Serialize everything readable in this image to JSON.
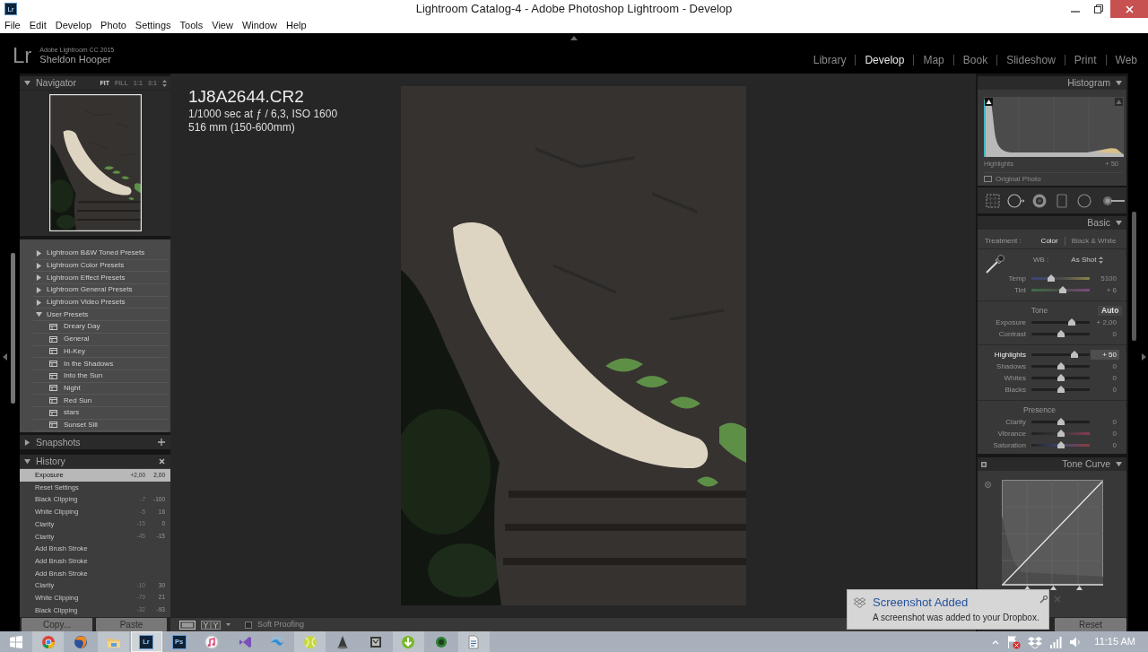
{
  "window": {
    "icon_label": "Lr",
    "title": "Lightroom Catalog-4 - Adobe Photoshop Lightroom - Develop"
  },
  "menu": [
    "File",
    "Edit",
    "Develop",
    "Photo",
    "Settings",
    "Tools",
    "View",
    "Window",
    "Help"
  ],
  "identity": {
    "logo": "Lr",
    "product": "Adobe Lightroom CC 2015",
    "user": "Sheldon Hooper"
  },
  "modules": [
    {
      "label": "Library",
      "selected": false
    },
    {
      "label": "Develop",
      "selected": true
    },
    {
      "label": "Map",
      "selected": false
    },
    {
      "label": "Book",
      "selected": false
    },
    {
      "label": "Slideshow",
      "selected": false
    },
    {
      "label": "Print",
      "selected": false
    },
    {
      "label": "Web",
      "selected": false
    }
  ],
  "left_panel": {
    "navigator": {
      "title": "Navigator",
      "expanded": true,
      "zoom_options": [
        {
          "label": "FIT",
          "selected": true
        },
        {
          "label": "FILL",
          "selected": false
        },
        {
          "label": "1:1",
          "selected": false
        },
        {
          "label": "3:1",
          "selected": false
        }
      ]
    },
    "presets": [
      {
        "label": "Lightroom B&W Toned Presets",
        "expanded": false
      },
      {
        "label": "Lightroom Color Presets",
        "expanded": false
      },
      {
        "label": "Lightroom Effect Presets",
        "expanded": false
      },
      {
        "label": "Lightroom General Presets",
        "expanded": false
      },
      {
        "label": "Lightroom Video Presets",
        "expanded": false
      },
      {
        "label": "User Presets",
        "expanded": true,
        "children": [
          {
            "label": "Dreary Day"
          },
          {
            "label": "General"
          },
          {
            "label": "Hi-Key"
          },
          {
            "label": "In the Shadows"
          },
          {
            "label": "Into the Sun"
          },
          {
            "label": "Night"
          },
          {
            "label": "Red Sun"
          },
          {
            "label": "stars"
          },
          {
            "label": "Sunset Sill"
          }
        ]
      }
    ],
    "snapshots": {
      "title": "Snapshots",
      "expanded": false
    },
    "history": {
      "title": "History",
      "expanded": true,
      "steps": [
        {
          "label": "Exposure",
          "change": "+2,00",
          "value": "2,00",
          "selected": true
        },
        {
          "label": "Reset Settings",
          "selected": false
        },
        {
          "label": "Black Clipping",
          "change": "-7",
          "value": "-100",
          "selected": false
        },
        {
          "label": "White Clipping",
          "change": "-5",
          "value": "16",
          "selected": false
        },
        {
          "label": "Clarity",
          "change": "-15",
          "value": "0",
          "selected": false
        },
        {
          "label": "Clarity",
          "change": "-45",
          "value": "-15",
          "selected": false
        },
        {
          "label": "Add Brush Stroke",
          "selected": false
        },
        {
          "label": "Add Brush Stroke",
          "selected": false
        },
        {
          "label": "Add Brush Stroke",
          "selected": false
        },
        {
          "label": "Clarity",
          "change": "-10",
          "value": "30",
          "selected": false
        },
        {
          "label": "White Clipping",
          "change": "-79",
          "value": "21",
          "selected": false
        },
        {
          "label": "Black Clipping",
          "change": "-32",
          "value": "-93",
          "selected": false
        }
      ]
    },
    "buttons": [
      {
        "label": "Copy..."
      },
      {
        "label": "Paste"
      }
    ]
  },
  "center": {
    "photo_info": {
      "filename": "1J8A2644.CR2",
      "exposure": "1/1000 sec at ƒ / 6,3, ISO 1600",
      "lens": "516 mm (150-600mm)"
    },
    "toolbar": {
      "soft_proofing": {
        "label": "Soft Proofing",
        "checked": false
      }
    }
  },
  "right_panel": {
    "histogram": {
      "title": "Histogram",
      "expanded": true,
      "readout_label": "Highlights",
      "readout_value": "+ 50",
      "original_photo": {
        "label": "Original Photo",
        "checked": false
      }
    },
    "basic": {
      "title": "Basic",
      "expanded": true,
      "treatment": {
        "label": "Treatment :",
        "options": [
          {
            "label": "Color",
            "selected": true
          },
          {
            "label": "Black & White",
            "selected": false
          }
        ]
      },
      "white_balance": {
        "label": "WB :",
        "value": "As Shot"
      },
      "sections": [
        {
          "sliders": [
            {
              "label": "Temp",
              "kind": "temp",
              "level": 0.34,
              "reading": "5100",
              "selected": false
            },
            {
              "label": "Tint",
              "kind": "tint",
              "level": 0.54,
              "reading": "+ 6",
              "selected": false
            }
          ]
        },
        {
          "title": "Tone",
          "action": "Auto",
          "sliders": [
            {
              "label": "Exposure",
              "kind": "plain",
              "level": 0.69,
              "reading": "+ 2,00",
              "selected": false
            },
            {
              "label": "Contrast",
              "kind": "plain",
              "level": 0.5,
              "reading": "0",
              "selected": false
            }
          ]
        },
        {
          "sliders": [
            {
              "label": "Highlights",
              "kind": "plain",
              "level": 0.74,
              "reading": "+ 50",
              "selected": true
            },
            {
              "label": "Shadows",
              "kind": "plain",
              "level": 0.5,
              "reading": "0",
              "selected": false
            },
            {
              "label": "Whites",
              "kind": "plain",
              "level": 0.5,
              "reading": "0",
              "selected": false
            },
            {
              "label": "Blacks",
              "kind": "plain",
              "level": 0.5,
              "reading": "0",
              "selected": false
            }
          ]
        },
        {
          "title": "Presence",
          "sliders": [
            {
              "label": "Clarity",
              "kind": "plain",
              "level": 0.5,
              "reading": "0",
              "selected": false
            },
            {
              "label": "Vibrance",
              "kind": "vibrance",
              "level": 0.5,
              "reading": "0",
              "selected": false
            },
            {
              "label": "Saturation",
              "kind": "saturation",
              "level": 0.5,
              "reading": "0",
              "selected": false
            }
          ]
        }
      ]
    },
    "tone_curve": {
      "title": "Tone Curve",
      "expanded": true
    },
    "buttons": [
      {
        "label": "Reset"
      }
    ]
  },
  "notification": {
    "title": "Screenshot Added",
    "message": "A screenshot was added to your Dropbox."
  },
  "taskbar": {
    "apps": [
      {
        "kind": "wheel",
        "running": true,
        "selected": false
      },
      {
        "kind": "globe",
        "running": false,
        "selected": false
      },
      {
        "kind": "folder",
        "running": true,
        "selected": false
      },
      {
        "kind": "badge",
        "label": "Lr",
        "running": true,
        "selected": true
      },
      {
        "kind": "badge",
        "label": "Ps",
        "running": false,
        "selected": false
      },
      {
        "kind": "music",
        "running": false,
        "selected": false
      },
      {
        "kind": "ribbon",
        "running": false,
        "selected": false
      },
      {
        "kind": "wave",
        "running": false,
        "selected": false
      },
      {
        "kind": "ball",
        "running": true,
        "selected": false
      },
      {
        "kind": "cone",
        "running": false,
        "selected": false
      },
      {
        "kind": "frame",
        "running": false,
        "selected": false
      },
      {
        "kind": "arrow",
        "running": true,
        "selected": false
      },
      {
        "kind": "dot",
        "running": false,
        "selected": false
      },
      {
        "kind": "document",
        "running": true,
        "selected": false
      }
    ],
    "clock": "11:15 AM"
  }
}
